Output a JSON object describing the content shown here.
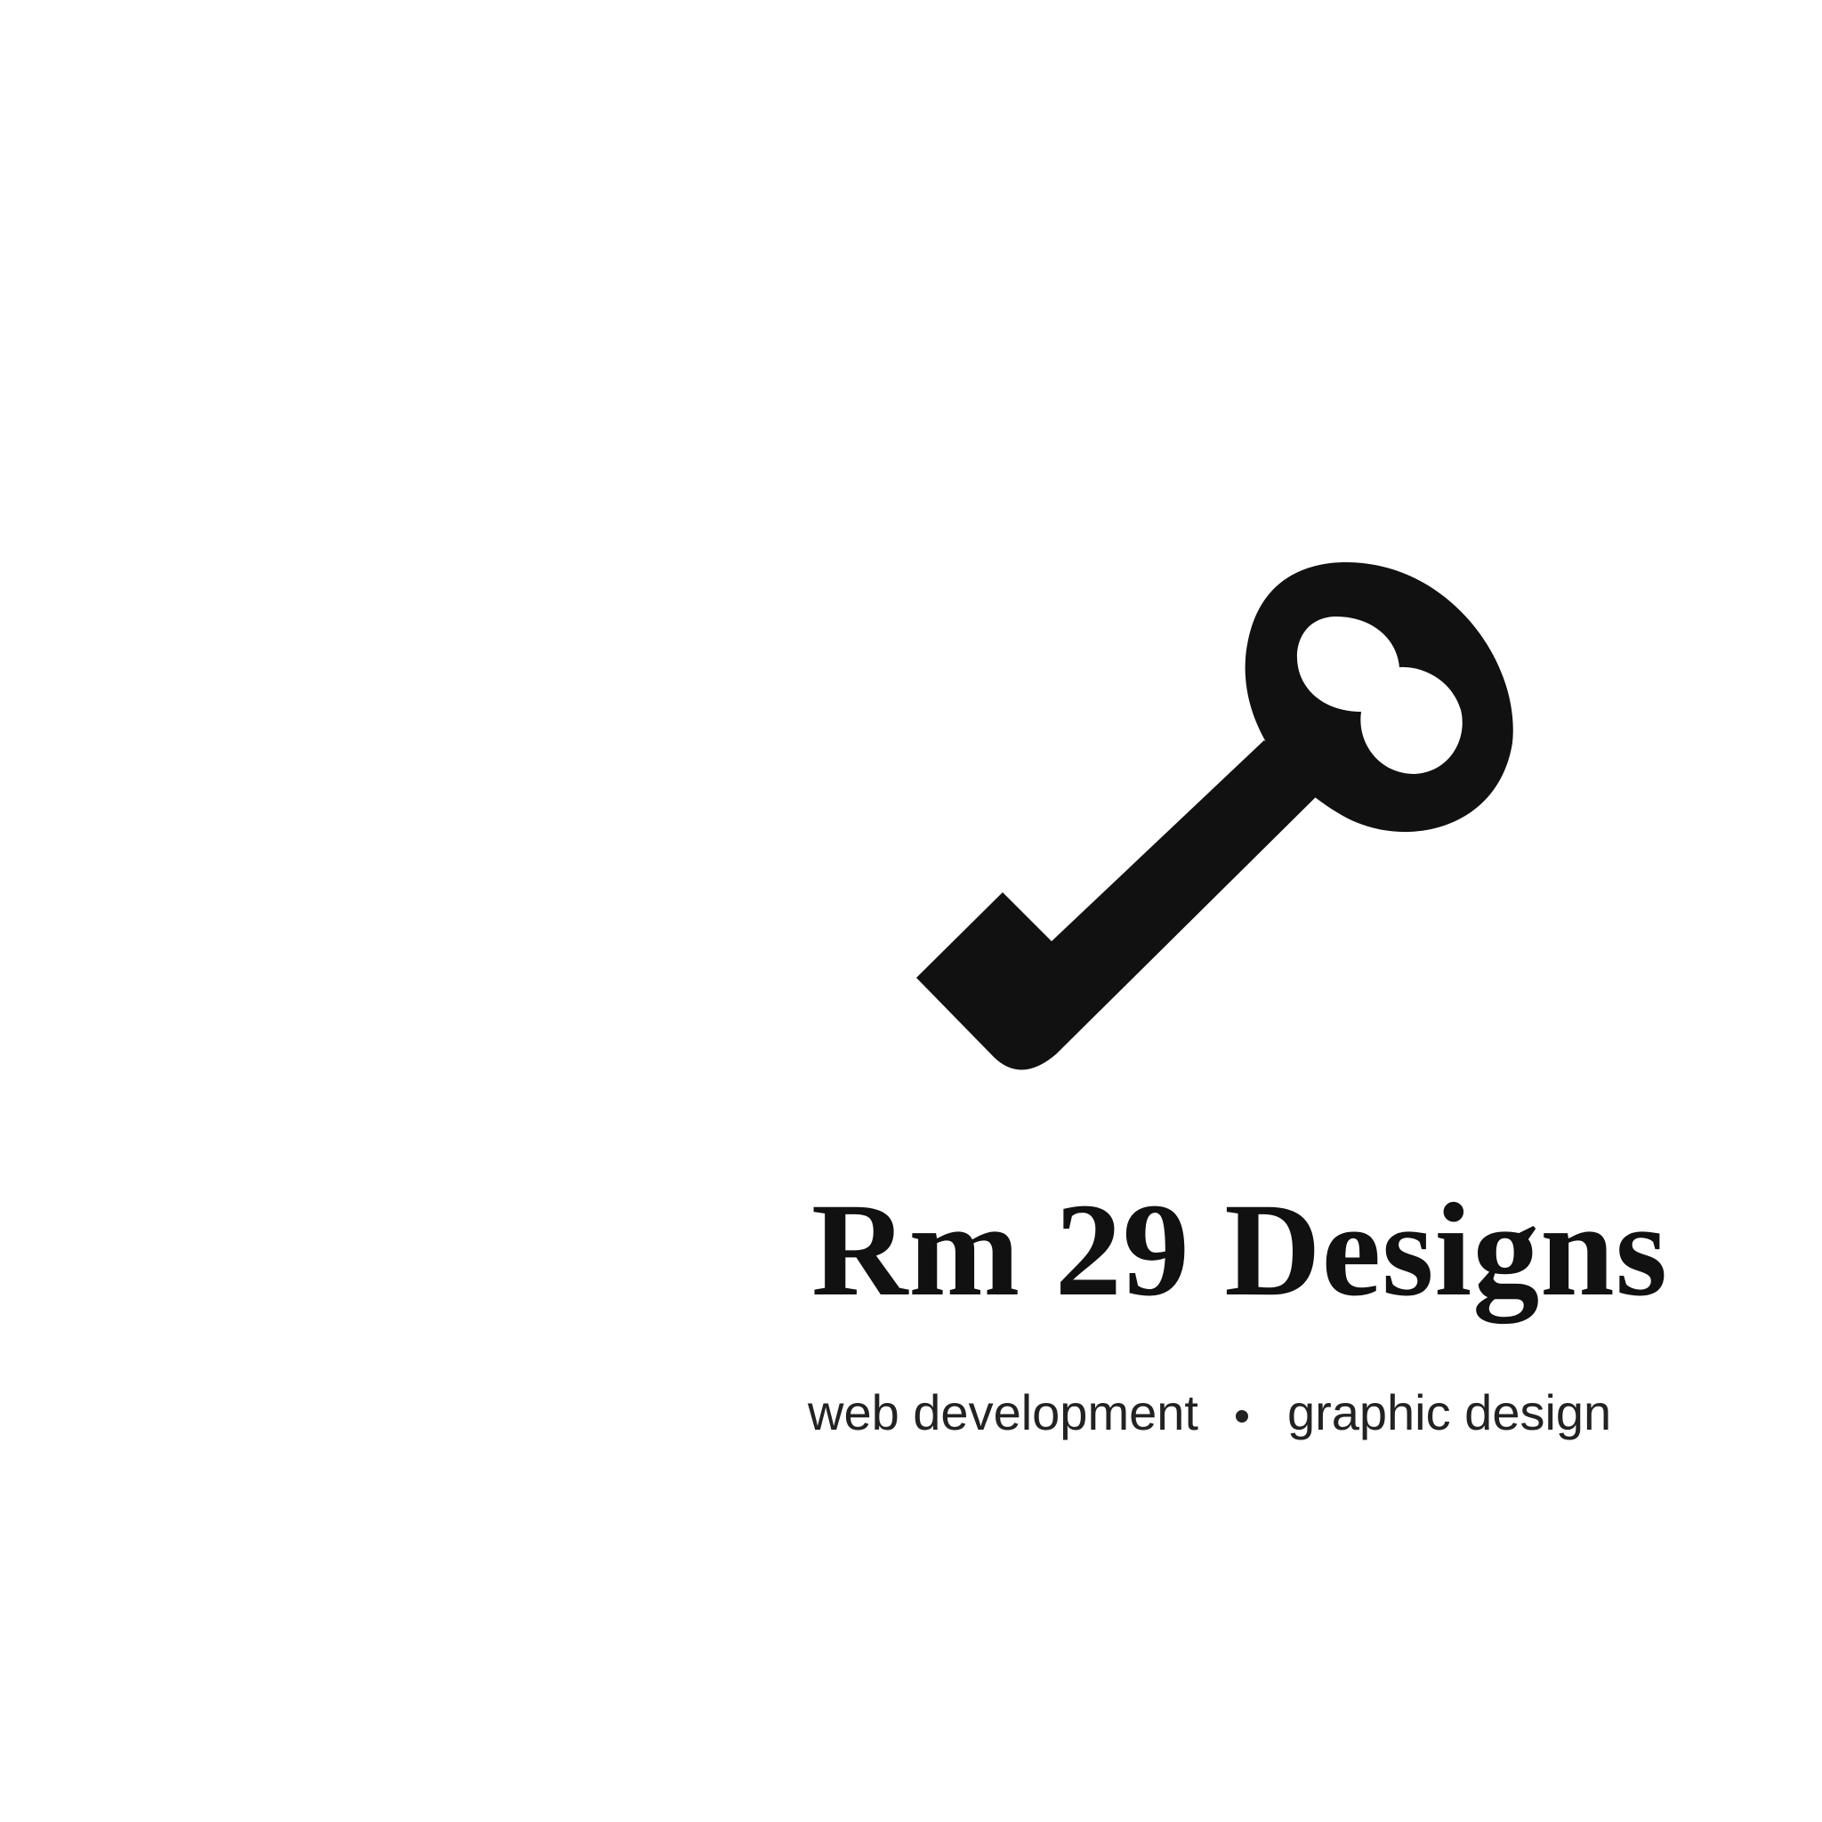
{
  "brand": {
    "name": "Rm 29 Designs",
    "tagline_left": "web development",
    "tagline_right": "graphic design",
    "logo_icon": "key-icon",
    "ink_color": "#111111",
    "background_color": "#ffffff"
  }
}
